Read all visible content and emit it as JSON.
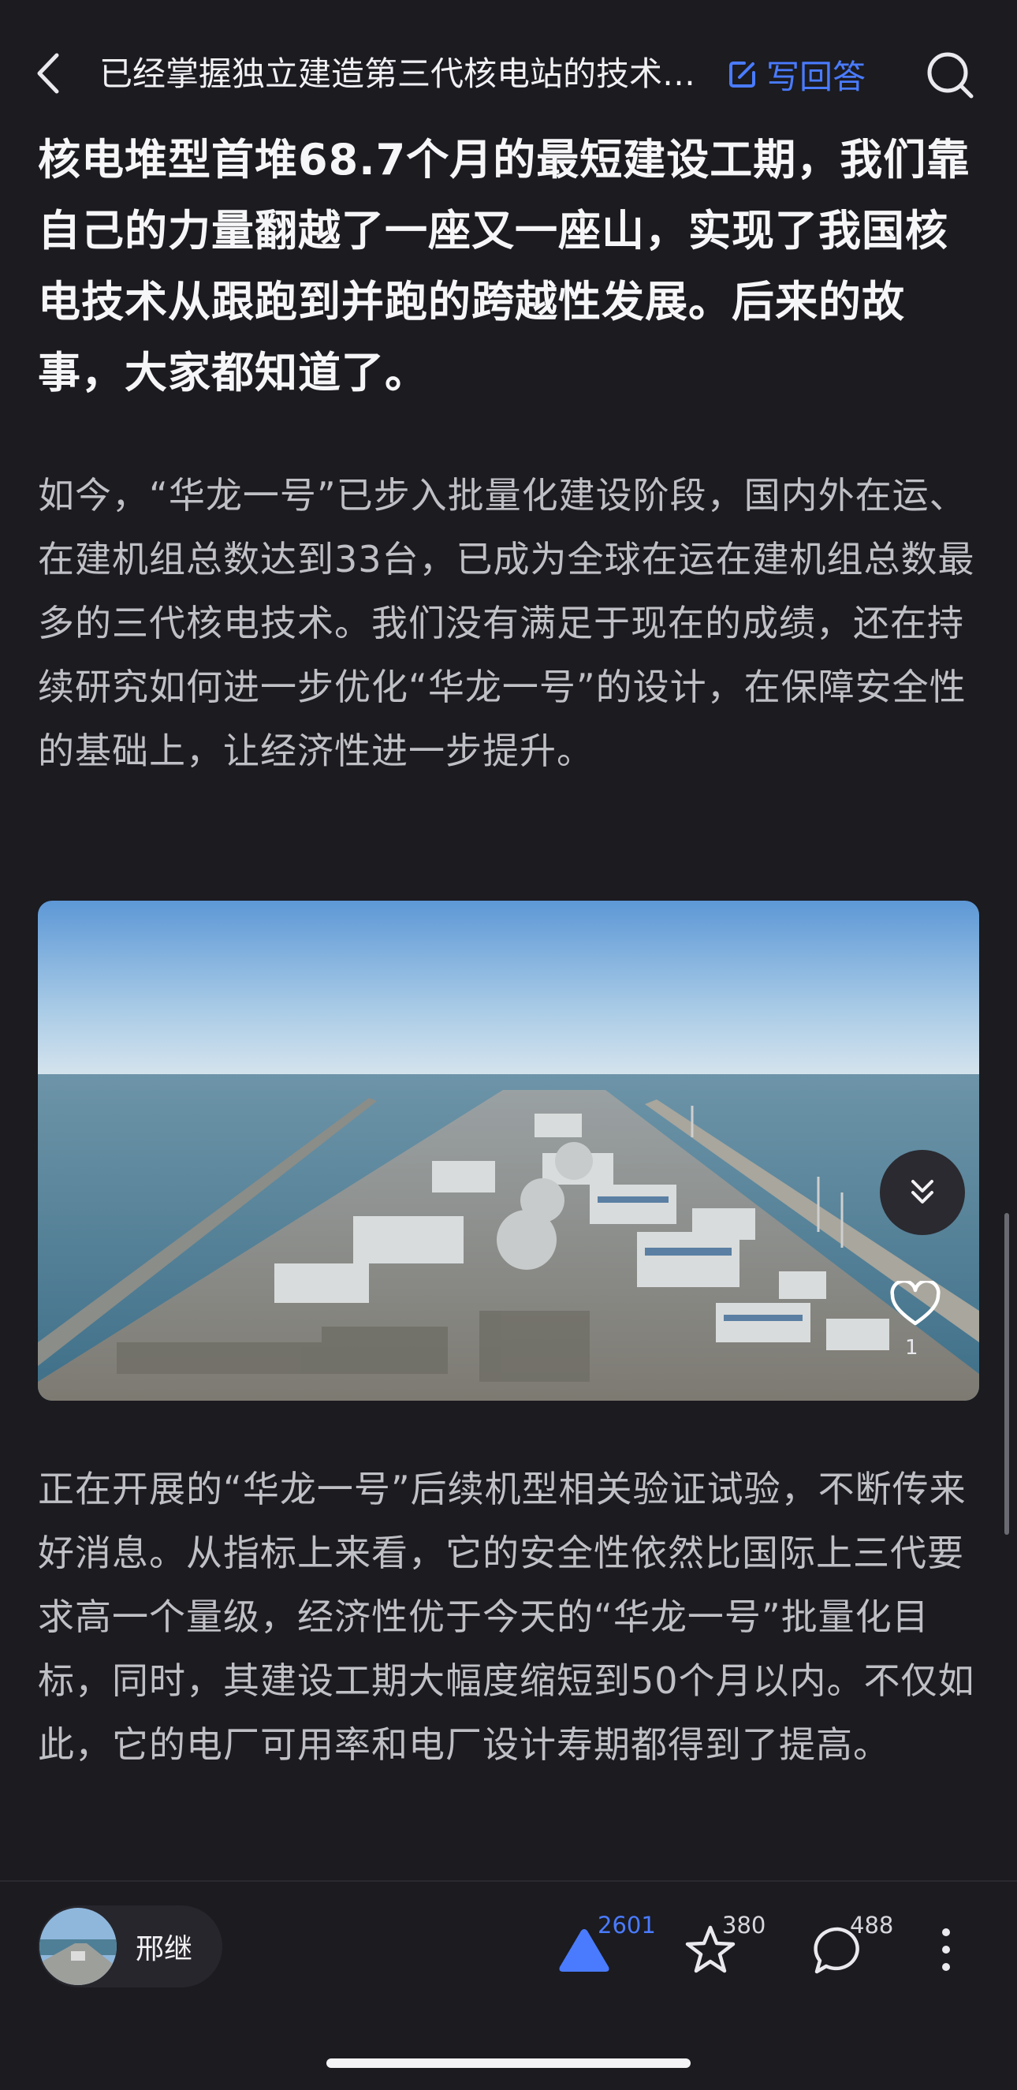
{
  "header": {
    "title": "已经掌握独立建造第三代核电站的技术了吗？",
    "write_answer_label": "写回答"
  },
  "article": {
    "bold_paragraph": "核电堆型首堆68.7个月的最短建设工期，我们靠自己的力量翻越了一座又一座山，实现了我国核电技术从跟跑到并跑的跨越性发展。后来的故事，大家都知道了。",
    "paragraph_1": "如今，“华龙一号”已步入批量化建设阶段，国内外在运、在建机组总数达到33台，已成为全球在运在建机组总数最多的三代核电技术。我们没有满足于现在的成绩，还在持续研究如何进一步优化“华龙一号”的设计，在保障安全性的基础上，让经济性进一步提升。",
    "paragraph_2": "正在开展的“华龙一号”后续机型相关验证试验，不断传来好消息。从指标上来看，它的安全性依然比国际上三代要求高一个量级，经济性优于今天的“华龙一号”批量化目标，同时，其建设工期大幅度缩短到50个月以内。不仅如此，它的电厂可用率和电厂设计寿期都得到了提高。"
  },
  "image": {
    "like_count": "1",
    "collapse_icon": "double-chevron-down-icon",
    "like_icon": "heart-icon"
  },
  "bottom_bar": {
    "author_name": "邢继",
    "upvote_count": "2601",
    "favorite_count": "380",
    "comment_count": "488"
  },
  "colors": {
    "background": "#1b1b20",
    "accent": "#4a7bff"
  }
}
